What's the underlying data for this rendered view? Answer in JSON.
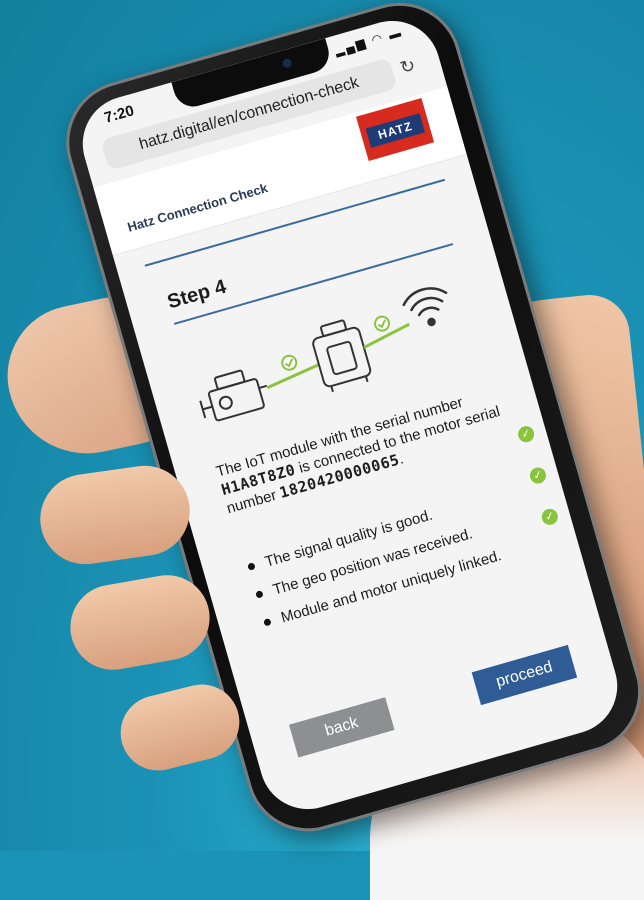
{
  "status": {
    "time": "7:20"
  },
  "browser": {
    "url": "hatz.digital/en/connection-check"
  },
  "site": {
    "title": "Hatz Connection Check",
    "logo_text": "HATZ",
    "brand_red": "#d72b1f",
    "brand_blue": "#1e3b75"
  },
  "step": {
    "title": "Step 4",
    "text_prefix": "The IoT module with the serial number ",
    "module_serial": "H1A8T8Z0",
    "text_middle": " is connected to the motor serial number ",
    "motor_serial": "1820420000065",
    "text_suffix": "."
  },
  "checklist": [
    {
      "label": "The signal quality is good.",
      "status": "ok"
    },
    {
      "label": "The geo position was received.",
      "status": "ok"
    },
    {
      "label": "Module and motor uniquely linked.",
      "status": "ok"
    }
  ],
  "buttons": {
    "back": "back",
    "proceed": "proceed"
  },
  "colors": {
    "accent_blue": "#2f5c95",
    "check_green": "#8ac43f",
    "back_gray": "#8d8f92"
  }
}
